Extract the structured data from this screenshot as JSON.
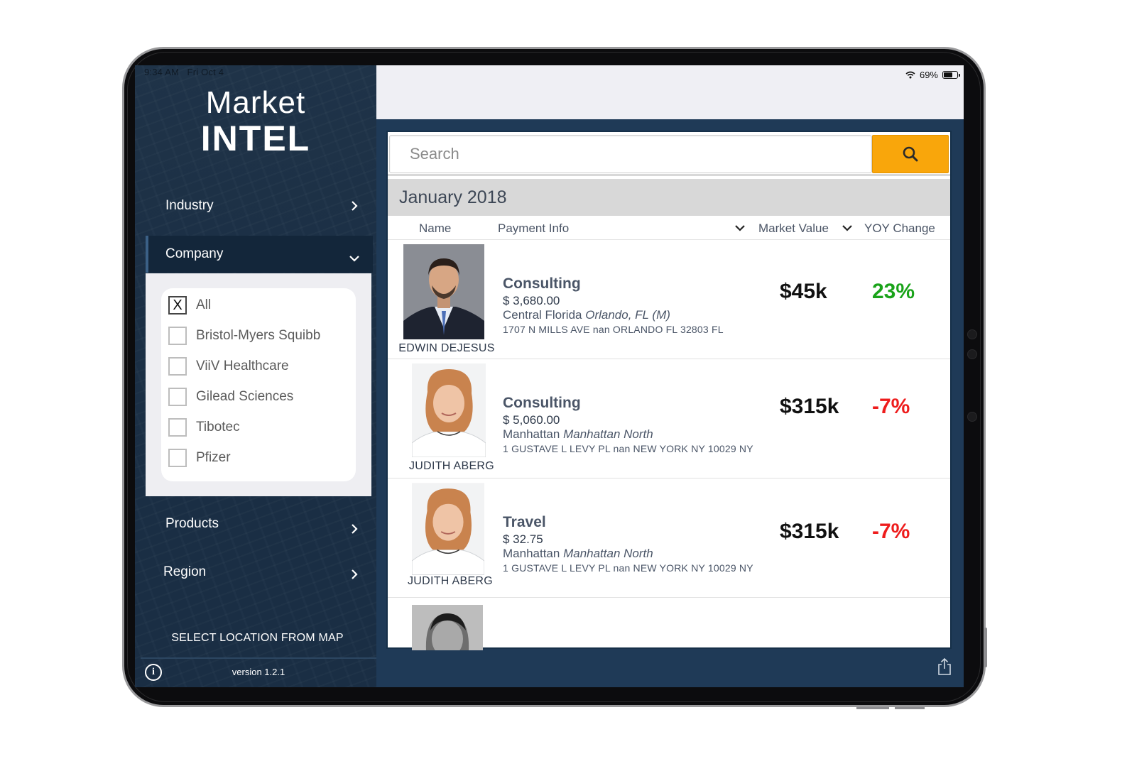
{
  "status_bar": {
    "time": "9:34 AM",
    "date": "Fri Oct 4",
    "battery": "69%"
  },
  "logo": {
    "line1": "Market",
    "line2": "INTEL"
  },
  "sidebar": {
    "nav": [
      {
        "label": "Industry"
      },
      {
        "label": "Company"
      },
      {
        "label": "Products"
      },
      {
        "label": "Region"
      }
    ],
    "companies": [
      {
        "label": "All",
        "checked": true,
        "mark": "X"
      },
      {
        "label": "Bristol-Myers Squibb",
        "checked": false,
        "mark": ""
      },
      {
        "label": "ViiV Healthcare",
        "checked": false,
        "mark": ""
      },
      {
        "label": "Gilead Sciences",
        "checked": false,
        "mark": ""
      },
      {
        "label": "Tibotec",
        "checked": false,
        "mark": ""
      },
      {
        "label": "Pfizer",
        "checked": false,
        "mark": ""
      }
    ],
    "map_link": "SELECT LOCATION FROM MAP",
    "version": "version 1.2.1"
  },
  "search": {
    "placeholder": "Search"
  },
  "month": "January 2018",
  "columns": {
    "name": "Name",
    "payment_info": "Payment Info",
    "market_value": "Market Value",
    "yoy_change": "YOY Change"
  },
  "rows": [
    {
      "name": "EDWIN DEJESUS",
      "type": "Consulting",
      "amount": "$ 3,680.00",
      "region": "Central Florida",
      "city": "Orlando, FL (M)",
      "address": "1707 N MILLS AVE nan ORLANDO FL 32803 FL",
      "market_value": "$45k",
      "yoy": "23%"
    },
    {
      "name": "JUDITH ABERG",
      "type": "Consulting",
      "amount": "$ 5,060.00",
      "region": "Manhattan",
      "city": "Manhattan North",
      "address": "1 GUSTAVE L LEVY PL nan NEW YORK NY 10029 NY",
      "market_value": "$315k",
      "yoy": "-7%"
    },
    {
      "name": "JUDITH ABERG",
      "type": "Travel",
      "amount": "$ 32.75",
      "region": "Manhattan",
      "city": "Manhattan North",
      "address": "1 GUSTAVE L LEVY PL nan NEW YORK NY 10029 NY",
      "market_value": "$315k",
      "yoy": "-7%"
    }
  ],
  "colors": {
    "positive": "#1aa31a",
    "negative": "#ee1c1c",
    "accent": "#f9a60b",
    "sidebar": "#1b2f45"
  },
  "icons": {
    "search": "search-icon",
    "share": "share-icon",
    "info": "info-icon",
    "chevron": "chevron-icon",
    "wifi": "wifi-icon",
    "battery": "battery-icon"
  }
}
